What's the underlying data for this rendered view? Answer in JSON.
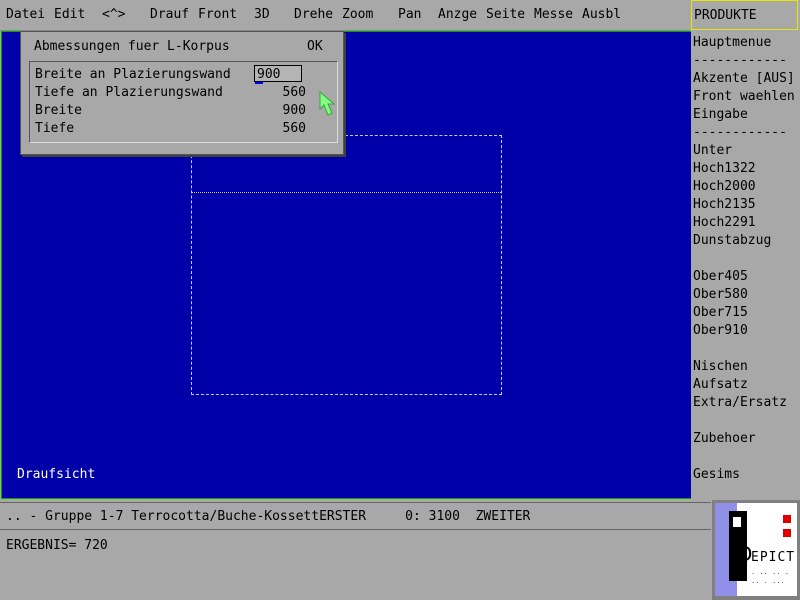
{
  "menubar": {
    "items": [
      "Datei",
      "Edit",
      "<^>",
      "Drauf",
      "Front",
      "3D",
      "Drehe",
      "Zoom",
      "Pan",
      "Anzge",
      "Seite",
      "Messe",
      "Ausbl"
    ]
  },
  "sidebar": {
    "header": "PRODUKTE",
    "items": [
      "Hauptmenue",
      "------------",
      "Akzente [AUS]",
      "Front waehlen",
      "Eingabe",
      "------------",
      "Unter",
      "Hoch1322",
      "Hoch2000",
      "Hoch2135",
      "Hoch2291",
      "Dunstabzug",
      "Ober405",
      "Ober580",
      "Ober715",
      "Ober910",
      "Nischen",
      "Aufsatz",
      "Extra/Ersatz",
      "Zubehoer",
      "Gesims"
    ]
  },
  "dialog": {
    "title": "Abmessungen fuer L-Korpus",
    "ok_label": "OK",
    "fields": [
      {
        "label": "Breite an Plazierungswand",
        "value": "900"
      },
      {
        "label": "Tiefe an Plazierungswand",
        "value": "560"
      },
      {
        "label": "Breite",
        "value": "900"
      },
      {
        "label": "Tiefe",
        "value": "560"
      }
    ]
  },
  "canvas": {
    "view_label": "Draufsicht"
  },
  "status": {
    "text": ".. - Gruppe 1-7 Terrocotta/Buche-KossettERSTER     0: 3100  ZWEITER"
  },
  "result": {
    "text": "ERGEBNIS= 720"
  },
  "colors": {
    "canvas_bg": "#0000a8",
    "panel_bg": "#a8a8a8",
    "accent_yellow": "#e6e600",
    "cursor_green": "#80ff80"
  },
  "icons": {
    "pointer": "arrow-pointer-icon",
    "logo": "depict-logo"
  }
}
